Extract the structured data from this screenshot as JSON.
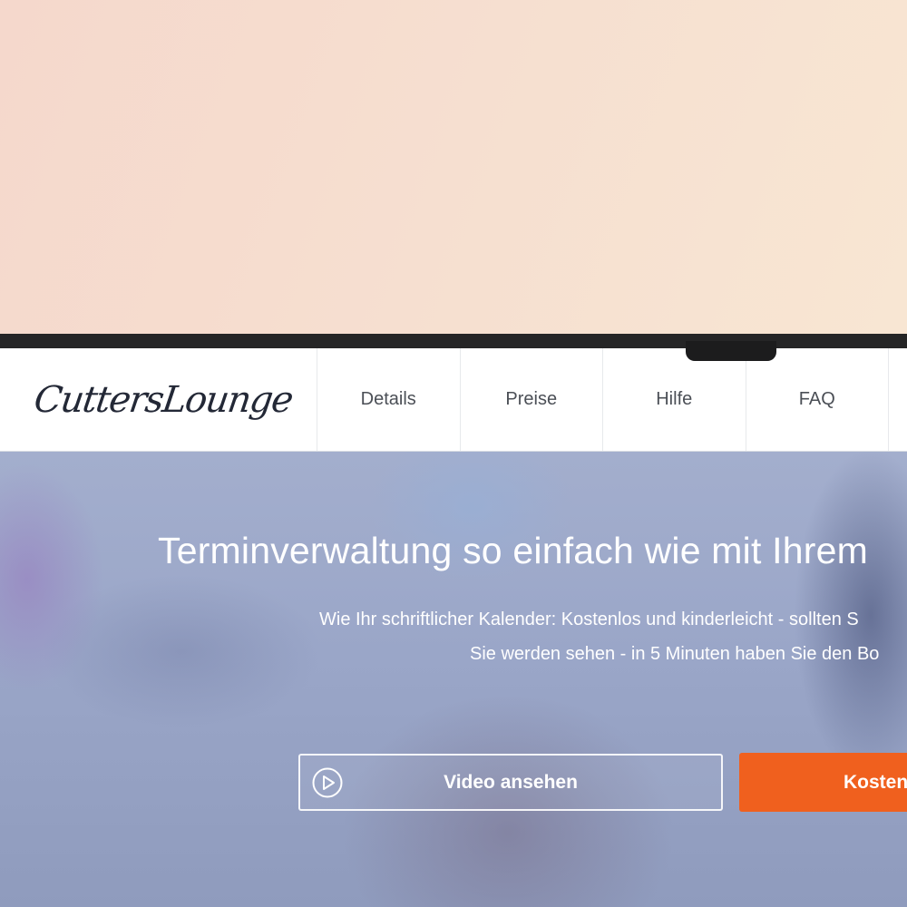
{
  "brand": {
    "logo_text": "CuttersLounge"
  },
  "nav": {
    "items": [
      {
        "label": "Details"
      },
      {
        "label": "Preise"
      },
      {
        "label": "Hilfe"
      },
      {
        "label": "FAQ"
      }
    ]
  },
  "hero": {
    "title": "Terminverwaltung so einfach wie mit Ihrem",
    "subtitle_line1": "Wie Ihr schriftlicher Kalender: Kostenlos und kinderleicht - sollten S",
    "subtitle_line2": "Sie werden sehen - in 5 Minuten haben Sie den Bo",
    "video_button_label": "Video ansehen",
    "video_button_icon": "play-icon",
    "cta_button_label": "Kosten"
  },
  "colors": {
    "cta": "#f0601e",
    "logo": "#232836",
    "bezel": "#252526"
  }
}
